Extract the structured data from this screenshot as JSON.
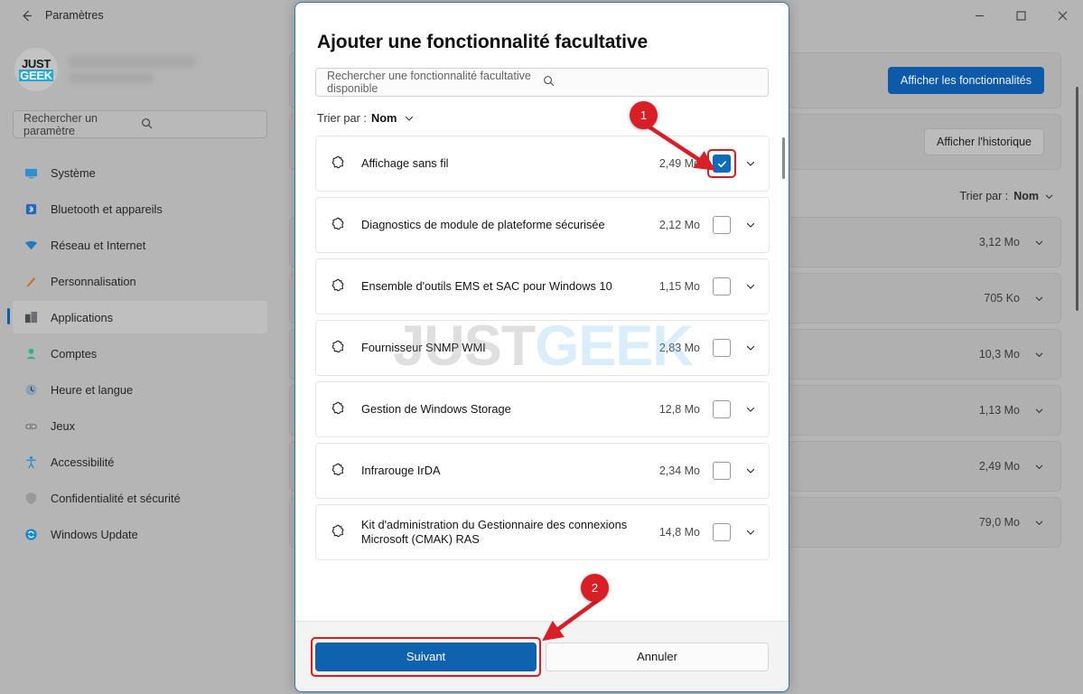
{
  "window": {
    "title": "Paramètres",
    "back_icon": "back-arrow-icon",
    "minimize_icon": "minimize-icon",
    "maximize_icon": "maximize-icon",
    "close_icon": "close-icon"
  },
  "sidebar": {
    "logo_top": "JUST",
    "logo_bottom": "GEEK",
    "search": {
      "placeholder": "Rechercher un paramètre",
      "icon": "search-icon"
    },
    "items": [
      {
        "label": "Système",
        "icon": "monitor-icon",
        "active": false
      },
      {
        "label": "Bluetooth et appareils",
        "icon": "bluetooth-icon",
        "active": false
      },
      {
        "label": "Réseau et Internet",
        "icon": "network-icon",
        "active": false
      },
      {
        "label": "Personnalisation",
        "icon": "paintbrush-icon",
        "active": false
      },
      {
        "label": "Applications",
        "icon": "apps-icon",
        "active": true
      },
      {
        "label": "Comptes",
        "icon": "account-icon",
        "active": false
      },
      {
        "label": "Heure et langue",
        "icon": "clock-icon",
        "active": false
      },
      {
        "label": "Jeux",
        "icon": "gamepad-icon",
        "active": false
      },
      {
        "label": "Accessibilité",
        "icon": "accessibility-icon",
        "active": false
      },
      {
        "label": "Confidentialité et sécurité",
        "icon": "shield-icon",
        "active": false
      },
      {
        "label": "Windows Update",
        "icon": "update-icon",
        "active": false
      }
    ]
  },
  "content": {
    "view_features_button": "Afficher les fonctionnalités",
    "view_history_button": "Afficher l'historique",
    "sort_prefix": "Trier par :",
    "sort_value": "Nom",
    "rows": [
      {
        "size": "3,12 Mo"
      },
      {
        "size": "705 Ko"
      },
      {
        "size": "10,3 Mo"
      },
      {
        "size": "1,13 Mo"
      },
      {
        "size": "2,49 Mo"
      },
      {
        "size": "79,0 Mo"
      }
    ]
  },
  "dialog": {
    "title": "Ajouter une fonctionnalité facultative",
    "search": {
      "placeholder": "Rechercher une fonctionnalité facultative disponible",
      "icon": "search-icon"
    },
    "sort_prefix": "Trier par :",
    "sort_value": "Nom",
    "features": [
      {
        "name": "Affichage sans fil",
        "size": "2,49 Mo",
        "checked": true
      },
      {
        "name": "Diagnostics de module de plateforme sécurisée",
        "size": "2,12 Mo",
        "checked": false
      },
      {
        "name": "Ensemble d'outils EMS et SAC pour Windows 10",
        "size": "1,15 Mo",
        "checked": false
      },
      {
        "name": "Fournisseur SNMP WMI",
        "size": "2,83 Mo",
        "checked": false
      },
      {
        "name": "Gestion de Windows Storage",
        "size": "12,8 Mo",
        "checked": false
      },
      {
        "name": "Infrarouge IrDA",
        "size": "2,34 Mo",
        "checked": false
      },
      {
        "name": "Kit d'administration du Gestionnaire des connexions Microsoft (CMAK) RAS",
        "size": "14,8 Mo",
        "checked": false
      }
    ],
    "next_button": "Suivant",
    "cancel_button": "Annuler"
  },
  "watermark": {
    "part1": "JUST",
    "part2": "GEEK"
  },
  "annotations": [
    {
      "number": "1"
    },
    {
      "number": "2"
    }
  ],
  "colors": {
    "accent_blue": "#0f62ad",
    "annotation_red": "#d81f26",
    "checkbox_blue": "#0f6cbd",
    "logo_cyan": "#25a8d8"
  }
}
